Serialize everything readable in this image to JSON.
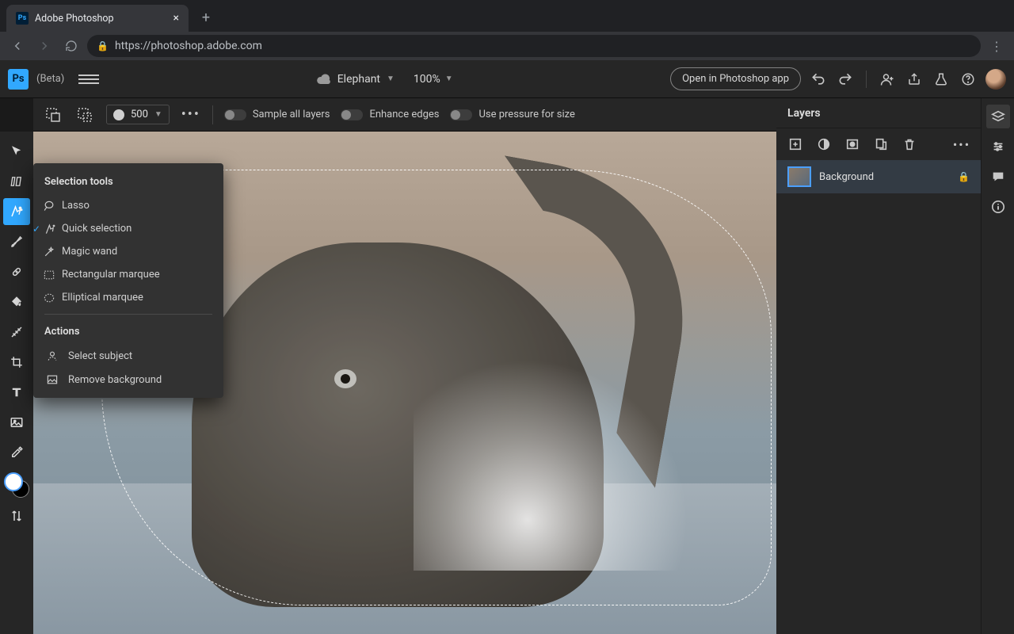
{
  "browser": {
    "tab_title": "Adobe Photoshop",
    "url": "https://photoshop.adobe.com"
  },
  "app": {
    "logo_text": "Ps",
    "beta_label": "(Beta)",
    "doc_name": "Elephant",
    "zoom_level": "100%",
    "open_desktop": "Open in Photoshop app"
  },
  "options": {
    "brush_size": "500",
    "sample_all": "Sample all layers",
    "enhance_edges": "Enhance edges",
    "use_pressure": "Use pressure for size"
  },
  "flyout": {
    "section1_title": "Selection tools",
    "items1": {
      "lasso": "Lasso",
      "quick": "Quick selection",
      "wand": "Magic wand",
      "rect": "Rectangular marquee",
      "ellipse": "Elliptical marquee"
    },
    "section2_title": "Actions",
    "items2": {
      "subject": "Select subject",
      "removebg": "Remove background"
    }
  },
  "layers": {
    "panel_title": "Layers",
    "bg_layer": "Background"
  }
}
